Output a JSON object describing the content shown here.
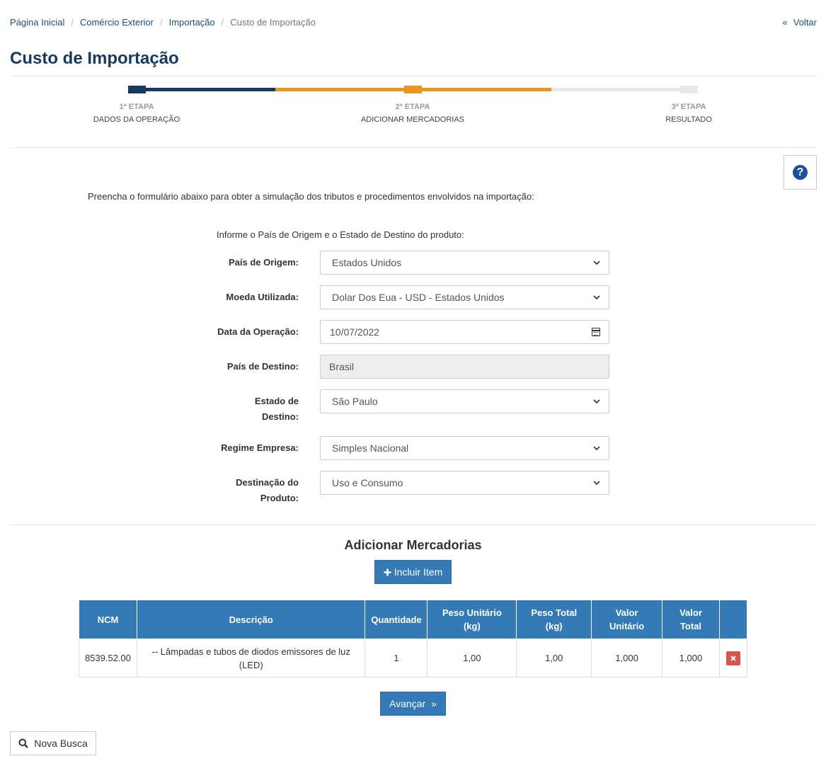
{
  "breadcrumb": {
    "items": [
      "Página Inicial",
      "Comércio Exterior",
      "Importação"
    ],
    "current": "Custo de Importação"
  },
  "back_label": "Voltar",
  "page_title": "Custo de Importação",
  "steps": [
    {
      "number": "1ª ETAPA",
      "title": "DADOS DA OPERAÇÃO"
    },
    {
      "number": "2ª ETAPA",
      "title": "ADICIONAR MERCADORIAS"
    },
    {
      "number": "3ª ETAPA",
      "title": "RESULTADO"
    }
  ],
  "colors": {
    "step_done": "#163a5f",
    "step_active": "#e8961e",
    "step_pending": "#e8e8e8",
    "primary": "#337ab7",
    "danger": "#d9534f"
  },
  "intro_text": "Preencha o formulário abaixo para obter a simulação dos tributos e procedimentos envolvidos na importação:",
  "info_text": "Informe o País de Origem e o Estado de Destino do produto:",
  "form": {
    "origem_label": "País de Origem:",
    "origem_value": "Estados Unidos",
    "moeda_label": "Moeda Utilizada:",
    "moeda_value": "Dolar Dos Eua - USD - Estados Unidos",
    "data_label": "Data da Operação:",
    "data_value": "10/07/2022",
    "destino_label": "País de Destino:",
    "destino_value": "Brasil",
    "estado_label_1": "Estado de",
    "estado_label_2": "Destino:",
    "estado_value": "São Paulo",
    "regime_label": "Regime Empresa:",
    "regime_value": "Simples Nacional",
    "destinacao_label_1": "Destinação do",
    "destinacao_label_2": "Produto:",
    "destinacao_value": "Uso e Consumo"
  },
  "section_title": "Adicionar Mercadorias",
  "add_item_label": "Incluir Item",
  "table": {
    "headers": {
      "ncm": "NCM",
      "descricao": "Descrição",
      "quantidade": "Quantidade",
      "peso_unit_1": "Peso Unitário",
      "peso_unit_2": "(kg)",
      "peso_total_1": "Peso Total",
      "peso_total_2": "(kg)",
      "valor_unit_1": "Valor",
      "valor_unit_2": "Unitário",
      "valor_total_1": "Valor",
      "valor_total_2": "Total"
    },
    "rows": [
      {
        "ncm": "8539.52.00",
        "descricao": "-- Lâmpadas e tubos de diodos emissores de luz (LED)",
        "quantidade": "1",
        "peso_unitario": "1,00",
        "peso_total": "1,00",
        "valor_unitario": "1,000",
        "valor_total": "1,000"
      }
    ]
  },
  "next_label": "Avançar",
  "new_search_label": "Nova Busca"
}
